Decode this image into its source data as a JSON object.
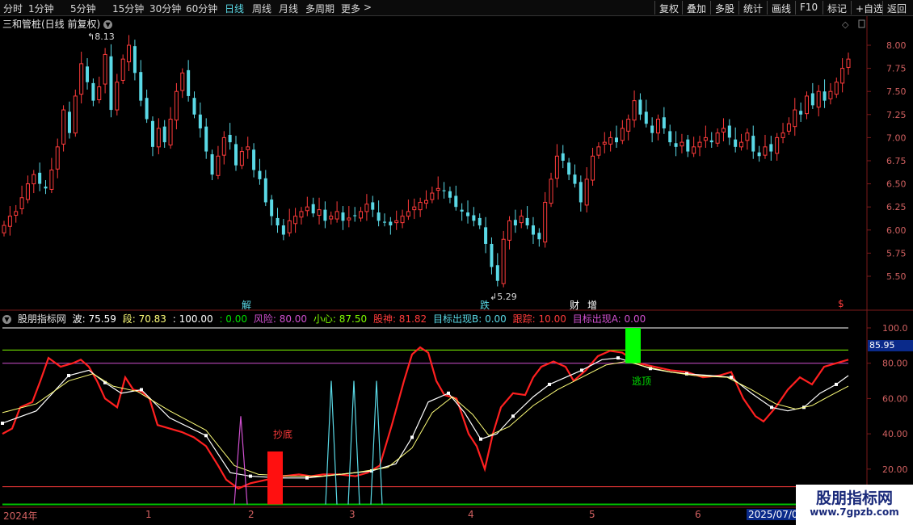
{
  "toolbar": {
    "periods": [
      "分时",
      "1分钟",
      "5分钟",
      "15分钟",
      "30分钟",
      "60分钟",
      "日线",
      "周线",
      "月线",
      "多周期",
      "更多"
    ],
    "more_arrow": ">",
    "right_buttons": [
      "复权",
      "叠加",
      "多股",
      "统计",
      "画线",
      "F10",
      "标记",
      "+自选",
      "返回"
    ]
  },
  "stock": {
    "title": "三和管桩(日线 前复权)",
    "high_label": "8.13",
    "low_label": "5.29"
  },
  "price_axis": [
    "8.00",
    "7.75",
    "7.50",
    "7.25",
    "7.00",
    "6.75",
    "6.50",
    "6.25",
    "6.00",
    "5.75",
    "5.50"
  ],
  "event_markers": [
    {
      "text": "解",
      "color": "#5ad9e6"
    },
    {
      "text": "跌",
      "color": "#5ad9e6"
    },
    {
      "text": "财",
      "color": "#ffffff"
    },
    {
      "text": "增",
      "color": "#ffffff"
    },
    {
      "text": "$",
      "color": "#ff3b3b"
    }
  ],
  "indicator": {
    "name": "股朋指标网",
    "values": [
      {
        "text": "波: 75.59",
        "color": "#ffffff"
      },
      {
        "text": "段: 70.83",
        "color": "#ffff7a"
      },
      {
        "text": ": 100.00",
        "color": "#ffffff"
      },
      {
        "text": ": 0.00",
        "color": "#00e000"
      },
      {
        "text": "风险: 80.00",
        "color": "#d050d0"
      },
      {
        "text": "小心: 87.50",
        "color": "#80ff00"
      },
      {
        "text": "股神: 81.82",
        "color": "#ff3b3b"
      },
      {
        "text": "目标出现B: 0.00",
        "color": "#5ad9e6"
      },
      {
        "text": "跟踪: 10.00",
        "color": "#ff3b3b"
      },
      {
        "text": "目标出现A: 0.00",
        "color": "#d050d0"
      }
    ],
    "axis": [
      "100.0",
      "80.00",
      "60.00",
      "40.00",
      "20.00"
    ],
    "current_value": "85.95",
    "bottom_label": "抄底",
    "top_label": "逃顶"
  },
  "time_axis": [
    "2024年",
    "1",
    "2",
    "3",
    "4",
    "5",
    "6",
    "2025/07/01"
  ],
  "watermark": {
    "line1": "股朋指标网",
    "line2": "www.7gpzb.com"
  },
  "colors": {
    "up": "#ff3b3b",
    "down": "#5ad9e6",
    "bg": "#000000"
  }
}
